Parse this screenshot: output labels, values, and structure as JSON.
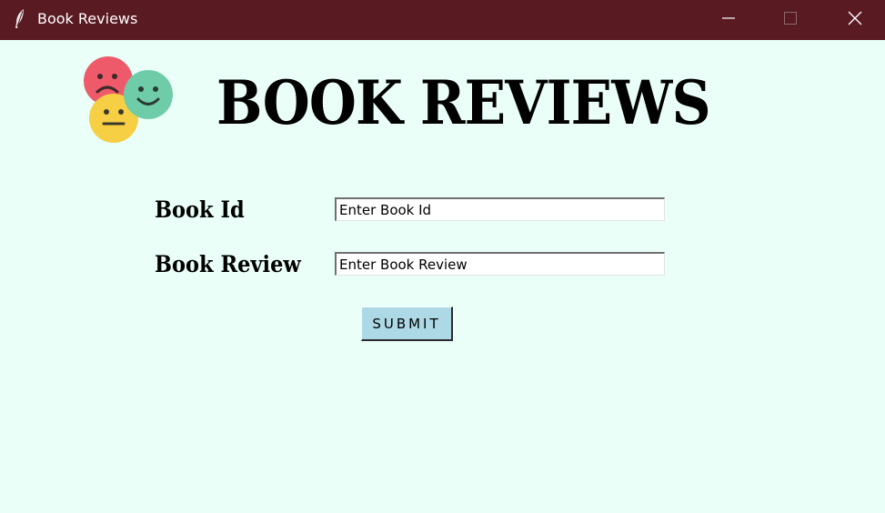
{
  "window": {
    "title": "Book Reviews",
    "titlebar_color": "#5a1a22",
    "app_icon": "feather-icon",
    "controls": [
      "minimize-icon",
      "maximize-icon",
      "close-icon"
    ]
  },
  "header": {
    "title": "BOOK REVIEWS",
    "logo": "emoji-faces-logo"
  },
  "form": {
    "book_id": {
      "label": "Book Id",
      "value": "Enter Book Id"
    },
    "book_review": {
      "label": "Book Review",
      "value": "Enter Book Review"
    },
    "submit_label": "SUBMIT"
  },
  "colors": {
    "background": "#e9fff8",
    "submit_button": "#add8e6",
    "sad_face": "#ef5a6a",
    "neutral_face": "#f7cf45",
    "happy_face": "#6fcca8"
  }
}
